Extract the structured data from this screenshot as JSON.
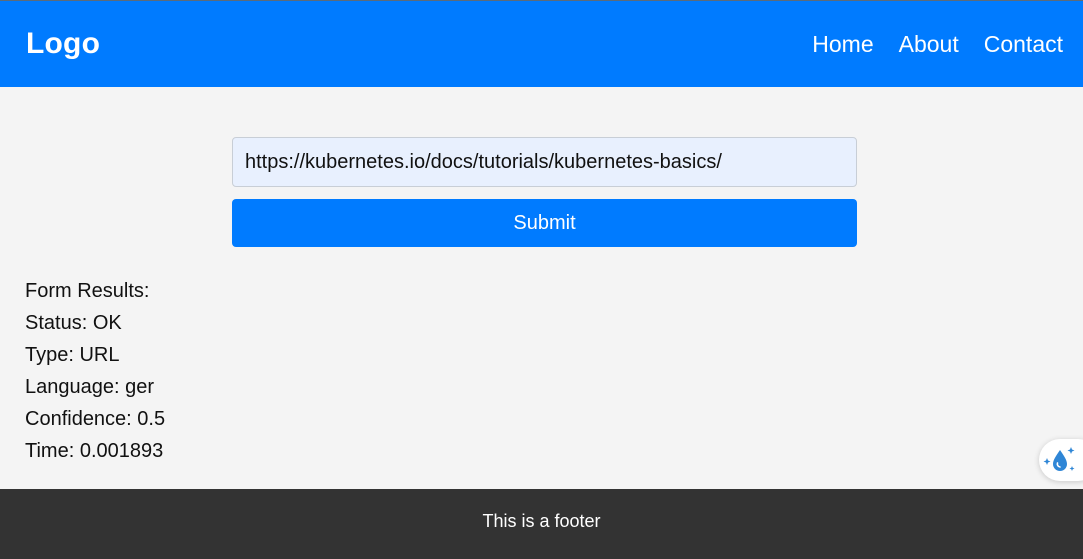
{
  "header": {
    "logo": "Logo",
    "nav": {
      "home": "Home",
      "about": "About",
      "contact": "Contact"
    },
    "background_color": "#007bff"
  },
  "form": {
    "url_value": "https://kubernetes.io/docs/tutorials/kubernetes-basics/",
    "submit_label": "Submit"
  },
  "results": {
    "title": "Form Results:",
    "status": "Status: OK",
    "type": "Type: URL",
    "language": "Language: ger",
    "confidence": "Confidence: 0.5",
    "time": "Time: 0.001893"
  },
  "floating_button": {
    "icon": "water-drop-sparkle-icon"
  },
  "footer": {
    "text": "This is a footer",
    "background_color": "#333333"
  }
}
